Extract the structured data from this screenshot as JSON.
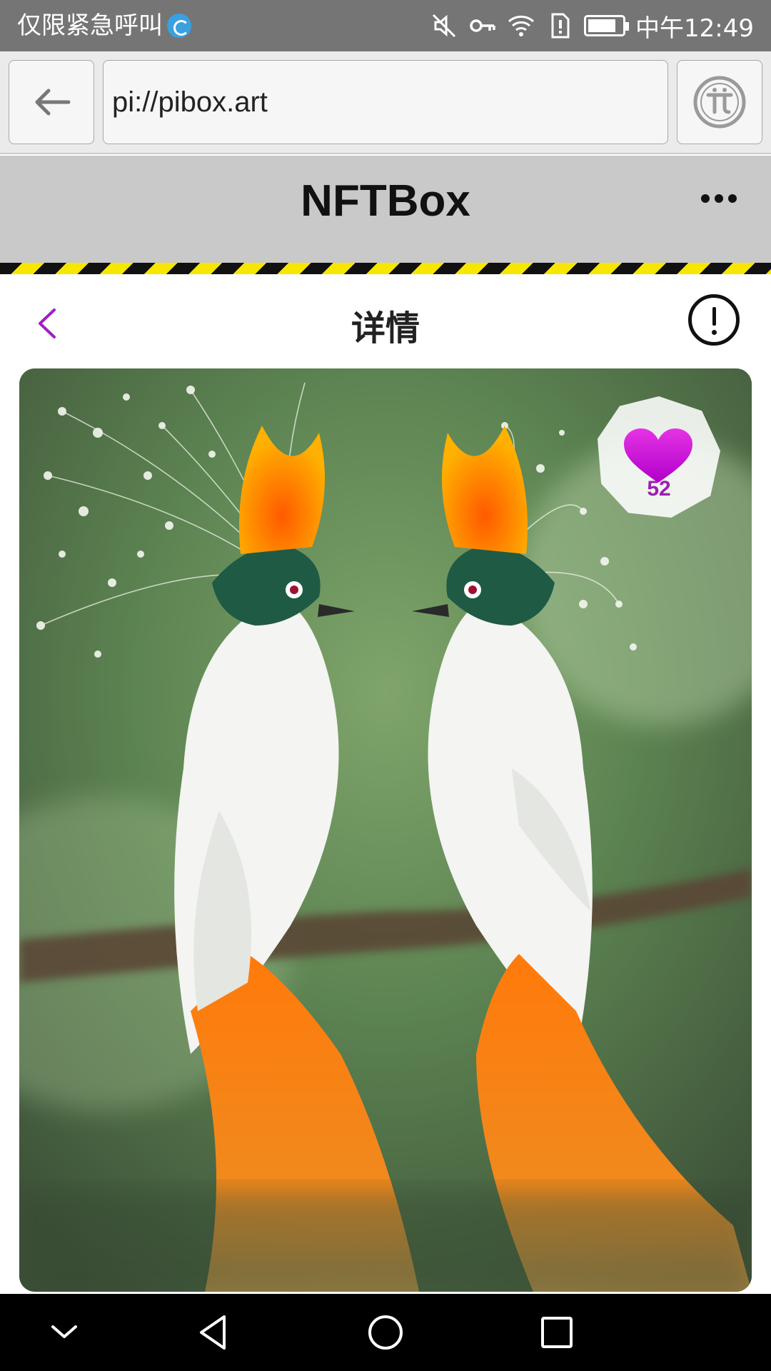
{
  "status_bar": {
    "left_text": "仅限紧急呼叫",
    "time": "中午12:49",
    "icons": [
      "app-notification-icon",
      "mute-icon",
      "key-icon",
      "wifi-icon",
      "sim-alert-icon",
      "battery-icon"
    ]
  },
  "browser": {
    "url": "pi://pibox.art",
    "back_icon": "arrow-left-icon",
    "pi_icon": "pi-logo-icon"
  },
  "app": {
    "title": "NFTBox",
    "menu_icon": "more-dots-icon"
  },
  "detail": {
    "title": "详情",
    "back_icon": "chevron-left-icon",
    "info_icon": "exclamation-circle-icon",
    "accent_color": "#a020c0"
  },
  "artwork": {
    "subject": "two white birds of paradise with orange crests and tails",
    "likes": "52",
    "like_icon": "heart-icon"
  },
  "system_nav": {
    "buttons": [
      "collapse-icon",
      "back-triangle-icon",
      "home-circle-icon",
      "recents-square-icon"
    ]
  }
}
